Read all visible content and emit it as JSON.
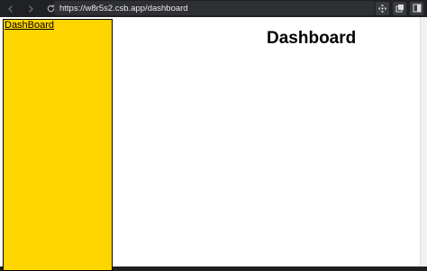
{
  "browser": {
    "url": "https://w8r5s2.csb.app/dashboard",
    "icons": {
      "back": "arrow-left-icon",
      "forward": "arrow-right-icon",
      "reload": "reload-icon",
      "extension_1": "move-icon",
      "extension_2": "window-copy-icon",
      "extension_3": "panel-icon"
    }
  },
  "sidebar": {
    "link_label": "DashBoard",
    "background_color": "#ffd500"
  },
  "main": {
    "title": "Dashboard"
  }
}
